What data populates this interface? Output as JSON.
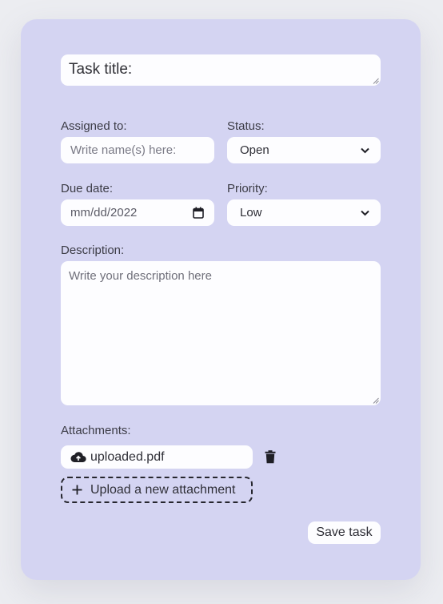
{
  "form": {
    "title_placeholder": "Task title:",
    "assigned": {
      "label": "Assigned to:",
      "placeholder": "Write name(s) here:"
    },
    "status": {
      "label": "Status:",
      "value": "Open"
    },
    "due_date": {
      "label": "Due date:",
      "value": "mm/dd/2022"
    },
    "priority": {
      "label": "Priority:",
      "value": "Low"
    },
    "description": {
      "label": "Description:",
      "placeholder": "Write your description here"
    },
    "attachments": {
      "label": "Attachments:",
      "file_name": "uploaded.pdf",
      "upload_label": "Upload a new attachment"
    },
    "save_label": "Save task"
  },
  "colors": {
    "page_bg": "#ecedf1",
    "card_bg": "#d4d4f2",
    "input_bg": "#fdfdff",
    "text": "#2c2c34"
  },
  "icons": [
    "cloud-upload-icon",
    "trash-icon",
    "plus-icon",
    "calendar-icon",
    "chevron-down-icon",
    "resize-grip-icon"
  ]
}
